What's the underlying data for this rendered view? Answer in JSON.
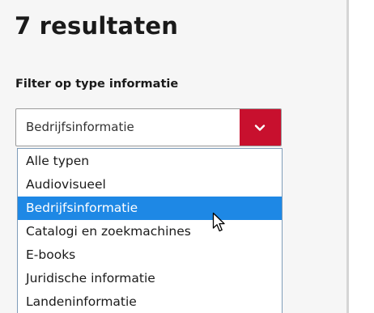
{
  "results": {
    "title": "7 resultaten"
  },
  "filter": {
    "label": "Filter op type informatie",
    "selected_value": "Bedrijfsinformatie",
    "toggle_icon": "chevron-down-icon",
    "accent_color": "#c8102e",
    "highlight_color": "#1e88e5",
    "options": [
      {
        "label": "Alle typen"
      },
      {
        "label": "Audiovisueel"
      },
      {
        "label": "Bedrijfsinformatie"
      },
      {
        "label": "Catalogi en zoekmachines"
      },
      {
        "label": "E-books"
      },
      {
        "label": "Juridische informatie"
      },
      {
        "label": "Landeninformatie"
      }
    ],
    "highlighted_index": 2
  },
  "cursor_icon": "mouse-pointer-icon"
}
